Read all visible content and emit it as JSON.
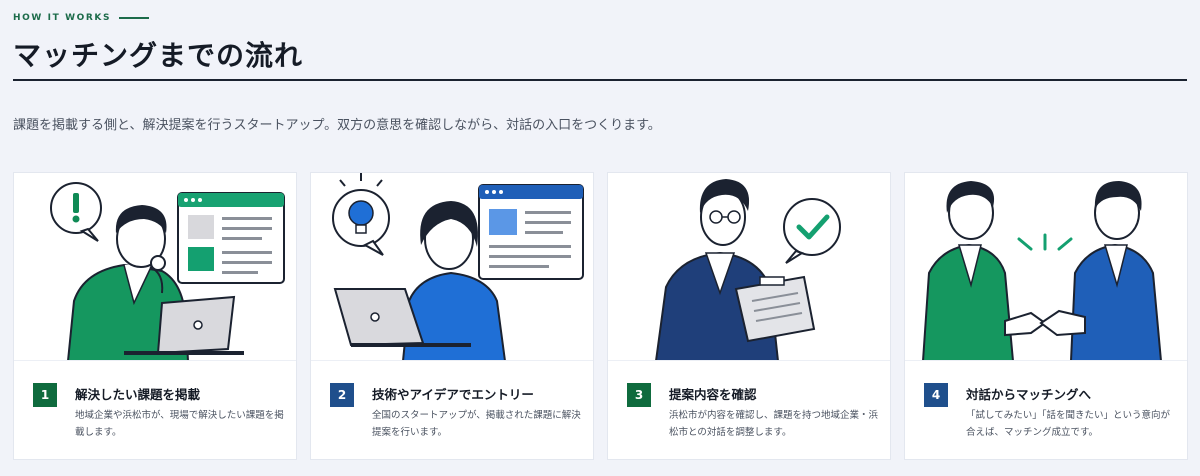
{
  "section": {
    "eyebrow": "HOW IT WORKS",
    "title": "マッチングまでの流れ",
    "lead": "課題を掲載する側と、解決提案を行うスタートアップ。双方の意思を確認しながら、対話の入口をつくります。"
  },
  "colors": {
    "green": "#0f6b3e",
    "blue": "#1f4f8c",
    "accent_green": "#14a070",
    "accent_blue": "#1f6fd6",
    "background": "#f1f3f9"
  },
  "steps": [
    {
      "number": "1",
      "title": "解決したい課題を掲載",
      "description": "地域企業や浜松市が、現場で解決したい課題を掲載します。",
      "badge_color": "#0f6b3e",
      "icon": "exclamation-bubble-icon"
    },
    {
      "number": "2",
      "title": "技術やアイデアでエントリー",
      "description": "全国のスタートアップが、掲載された課題に解決提案を行います。",
      "badge_color": "#1f4f8c",
      "icon": "lightbulb-bubble-icon"
    },
    {
      "number": "3",
      "title": "提案内容を確認",
      "description": "浜松市が内容を確認し、課題を持つ地域企業・浜松市との対話を調整します。",
      "badge_color": "#0f6b3e",
      "icon": "checkmark-bubble-icon"
    },
    {
      "number": "4",
      "title": "対話からマッチングへ",
      "description": "「試してみたい」「話を聞きたい」という意向が合えば、マッチング成立です。",
      "badge_color": "#1f4f8c",
      "icon": "handshake-icon"
    }
  ]
}
